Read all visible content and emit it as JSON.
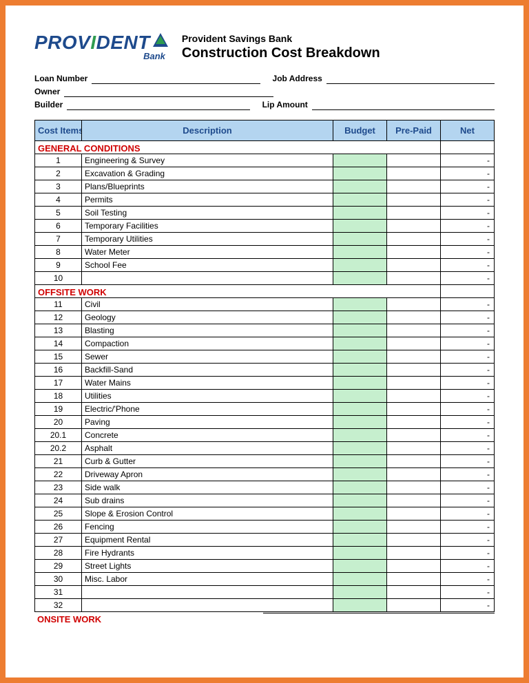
{
  "logo": {
    "prov": "PROV",
    "i": "I",
    "dent": "DENT",
    "bank": "Bank"
  },
  "header": {
    "bank_name": "Provident Savings Bank",
    "doc_title": "Construction Cost Breakdown"
  },
  "meta": {
    "loan_number": "Loan Number",
    "job_address": "Job Address",
    "owner": "Owner",
    "builder": "Builder",
    "lip_amount": "Lip Amount"
  },
  "columns": {
    "items": "Cost  Items",
    "desc": "Description",
    "budget": "Budget",
    "prepaid": "Pre-Paid",
    "net": "Net"
  },
  "sections": [
    {
      "title": "GENERAL CONDITIONS",
      "rows": [
        {
          "n": "1",
          "d": "Engineering & Survey",
          "net": "-"
        },
        {
          "n": "2",
          "d": "Excavation & Grading",
          "net": "-"
        },
        {
          "n": "3",
          "d": "Plans/Blueprints",
          "net": "-"
        },
        {
          "n": "4",
          "d": "Permits",
          "net": "-"
        },
        {
          "n": "5",
          "d": "Soil Testing",
          "net": "-"
        },
        {
          "n": "6",
          "d": "Temporary Facilities",
          "net": "-"
        },
        {
          "n": "7",
          "d": "Temporary Utilities",
          "net": "-"
        },
        {
          "n": "8",
          "d": "Water Meter",
          "net": "-"
        },
        {
          "n": "9",
          "d": "School Fee",
          "net": "-"
        },
        {
          "n": "10",
          "d": "",
          "net": "-"
        }
      ]
    },
    {
      "title": "OFFSITE WORK",
      "rows": [
        {
          "n": "11",
          "d": "Civil",
          "net": "-"
        },
        {
          "n": "12",
          "d": "Geology",
          "net": "-"
        },
        {
          "n": "13",
          "d": "Blasting",
          "net": "-"
        },
        {
          "n": "14",
          "d": "Compaction",
          "net": "-"
        },
        {
          "n": "15",
          "d": "Sewer",
          "net": "-"
        },
        {
          "n": "16",
          "d": "Backfill-Sand",
          "net": "-"
        },
        {
          "n": "17",
          "d": "Water Mains",
          "net": "-"
        },
        {
          "n": "18",
          "d": "Utilities",
          "net": "-"
        },
        {
          "n": "19",
          "d": "Electric/'Phone",
          "net": "-"
        },
        {
          "n": "20",
          "d": "Paving",
          "net": "-"
        },
        {
          "n": "20.1",
          "d": "Concrete",
          "net": "-"
        },
        {
          "n": "20.2",
          "d": "Asphalt",
          "net": "-"
        },
        {
          "n": "21",
          "d": "Curb & Gutter",
          "net": "-"
        },
        {
          "n": "22",
          "d": "Driveway Apron",
          "net": "-"
        },
        {
          "n": "23",
          "d": "Side walk",
          "net": "-"
        },
        {
          "n": "24",
          "d": "Sub drains",
          "net": "-"
        },
        {
          "n": "25",
          "d": "Slope & Erosion Control",
          "net": "-"
        },
        {
          "n": "26",
          "d": "Fencing",
          "net": "-"
        },
        {
          "n": "27",
          "d": "Equipment Rental",
          "net": "-"
        },
        {
          "n": "28",
          "d": "Fire Hydrants",
          "net": "-"
        },
        {
          "n": "29",
          "d": "Street Lights",
          "net": "-"
        },
        {
          "n": "30",
          "d": "Misc. Labor",
          "net": "-"
        },
        {
          "n": "31",
          "d": "",
          "net": "-"
        },
        {
          "n": "32",
          "d": "",
          "net": "-"
        }
      ]
    }
  ],
  "footer_section": "ONSITE WORK"
}
